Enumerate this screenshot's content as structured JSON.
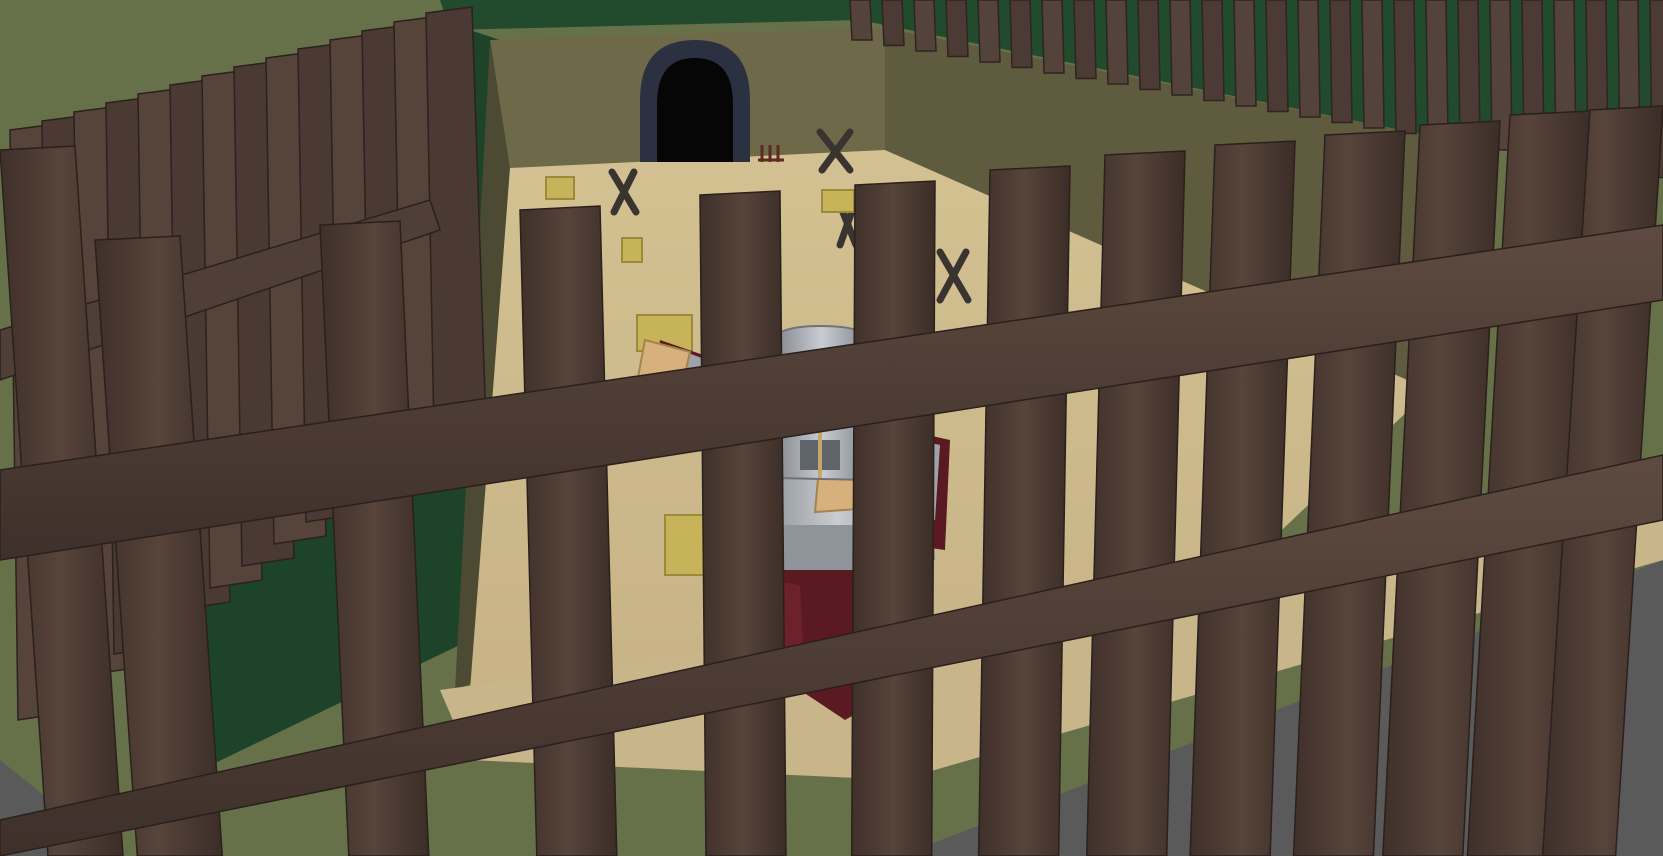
{
  "scene": {
    "type": "3d-game-viewport",
    "hud_text": []
  },
  "palette": {
    "grass": "#6d7a4a",
    "green_wall": "#1f4a2a",
    "inner_wall": "#6f6a4a",
    "sand_floor": "#cdb98e",
    "fence_wood": "#4a3a33",
    "fence_wood_light": "#5a463d",
    "stone_ground": "#5b5b5b",
    "armor_silver": "#a9adb3",
    "cloth_crimson": "#5a1a22",
    "skin": "#d8b07c",
    "hay": "#c9b55a"
  },
  "icons": {
    "character": "knight-icon",
    "doorway": "arch-door-icon",
    "obstacle": "x-barricade-icon",
    "crate": "hay-bale-icon"
  }
}
